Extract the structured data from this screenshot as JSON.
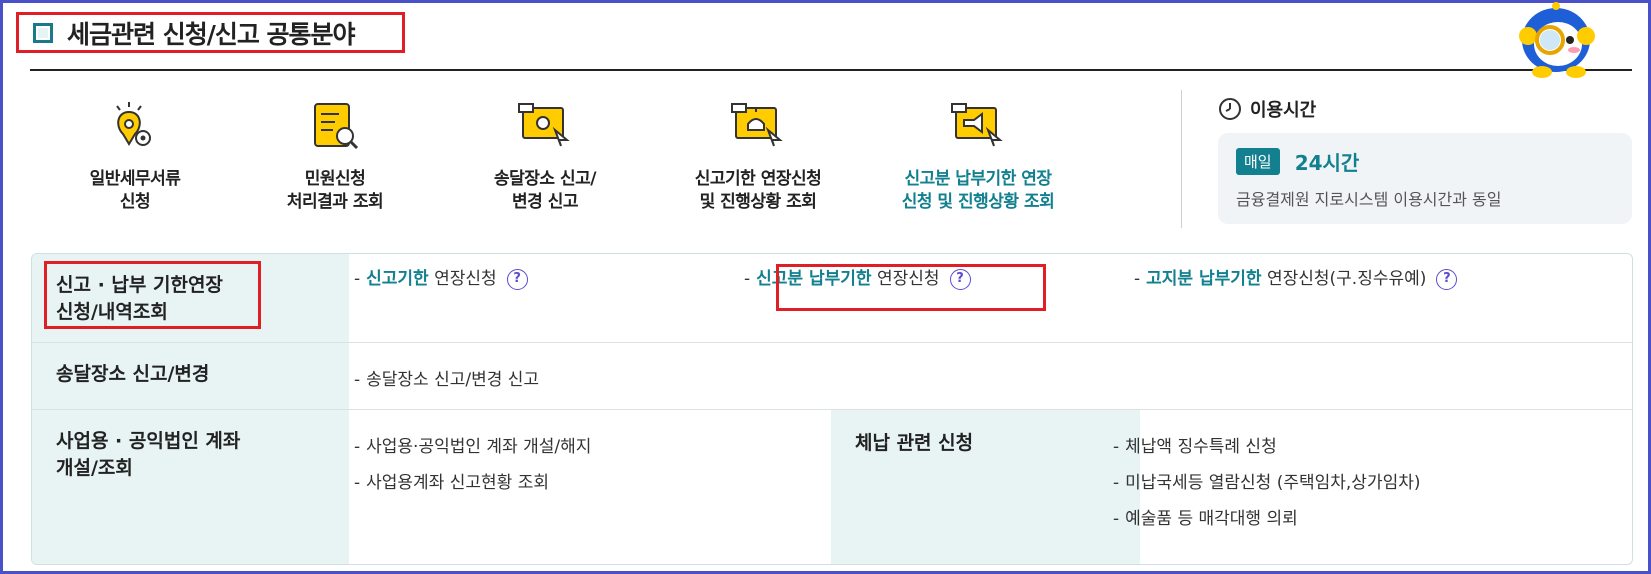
{
  "header": {
    "title": "세금관련 신청/신고 공통분야"
  },
  "menu": [
    {
      "label": "일반세무서류\n신청",
      "icon": "document-gear-icon"
    },
    {
      "label": "민원신청\n처리결과 조회",
      "icon": "document-search-icon"
    },
    {
      "label": "송달장소 신고/\n변경 신고",
      "icon": "mail-monitor-icon"
    },
    {
      "label": "신고기한 연장신청\n및 진행상황 조회",
      "icon": "alarm-monitor-icon"
    },
    {
      "label": "신고분 납부기한 연장\n신청 및 진행상황 조회",
      "icon": "megaphone-monitor-icon"
    }
  ],
  "usage": {
    "title": "이용시간",
    "badge": "매일",
    "hours": "24시간",
    "desc": "금융결제원 지로시스템 이용시간과 동일"
  },
  "table": {
    "row1": {
      "head": "신고 · 납부 기한연장\n신청/내역조회",
      "links": [
        {
          "em": "신고기한",
          "rest": "연장신청"
        },
        {
          "em": "신고분 납부기한",
          "rest": "연장신청"
        },
        {
          "em": "고지분 납부기한",
          "rest": "연장신청(구.징수유예)"
        }
      ]
    },
    "row2": {
      "head": "송달장소 신고/변경",
      "link": "송달장소 신고/변경 신고"
    },
    "row3": {
      "head": "사업용 · 공익법인 계좌\n개설/조회",
      "links": [
        "사업용·공익법인 계좌 개설/해지",
        "사업용계좌 신고현황 조회"
      ],
      "head2": "체납 관련 신청",
      "links2": [
        "체납액 징수특례 신청",
        "미납국세등 열람신청 (주택임차,상가임차)",
        "예술품 등 매각대행 의뢰"
      ]
    }
  },
  "qmark": "?",
  "dash": "-",
  "colors": {
    "accent": "#12808f",
    "highlight": "#e01e26",
    "frame": "#4a50c8"
  }
}
